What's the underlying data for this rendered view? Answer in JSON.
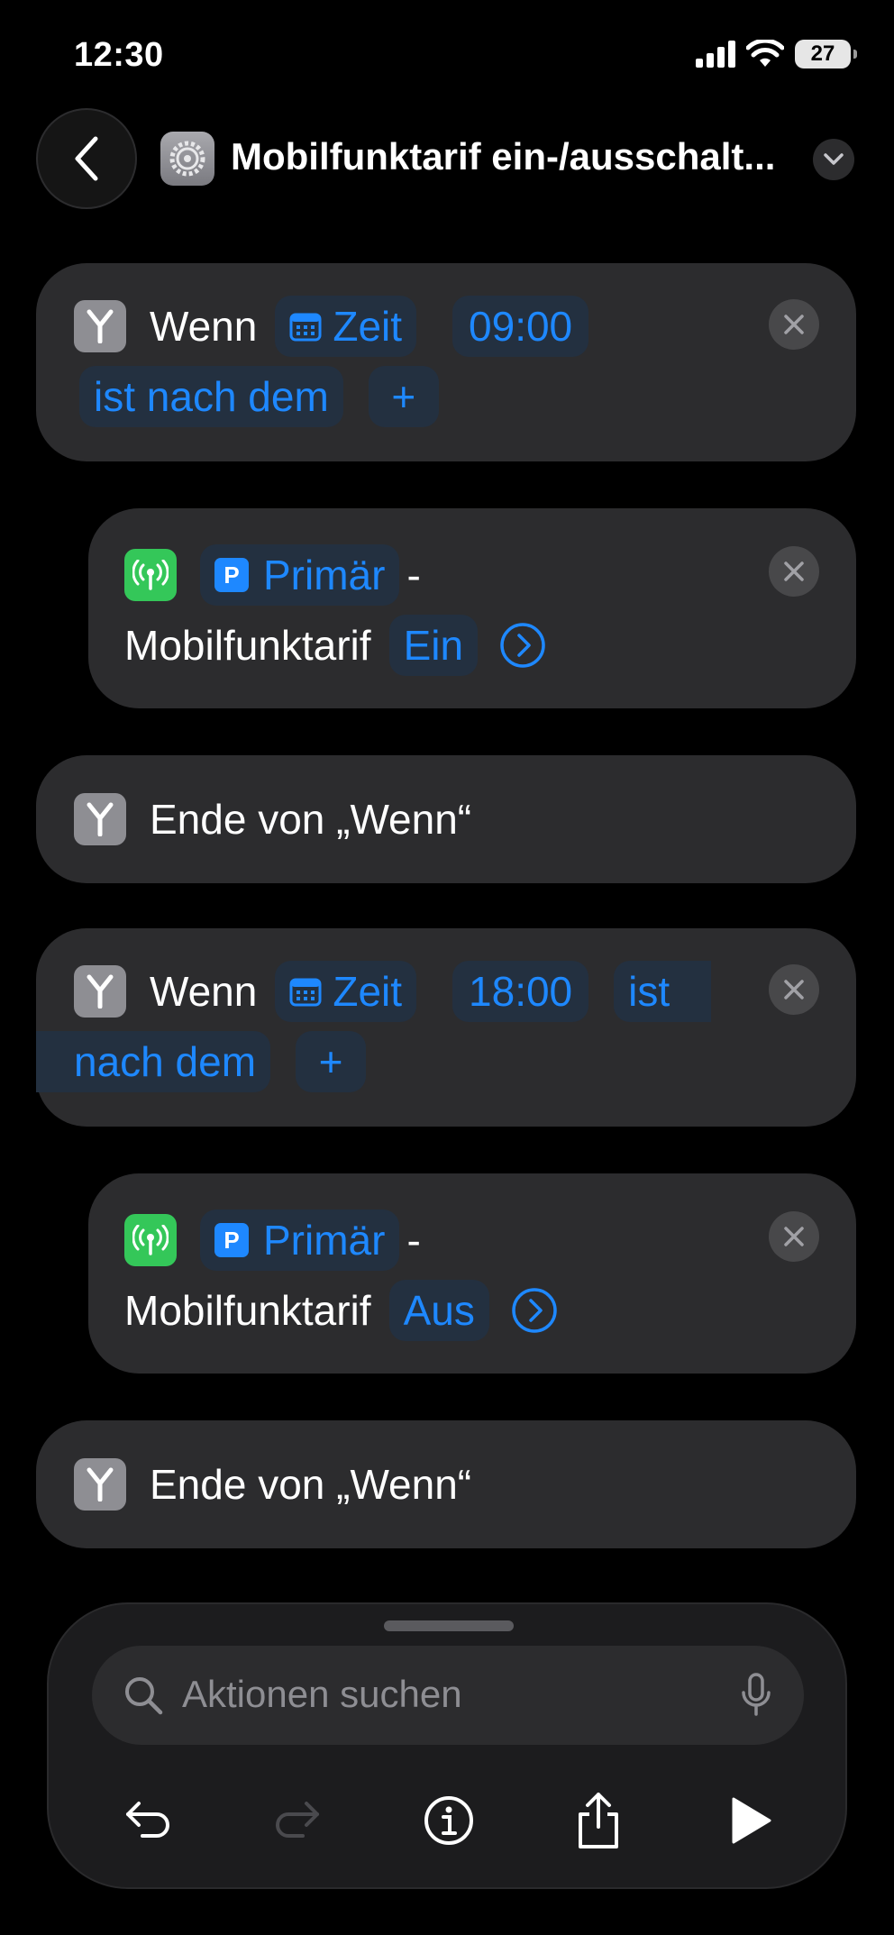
{
  "status": {
    "time": "12:30",
    "battery": "27"
  },
  "nav": {
    "title": "Mobilfunktarif ein-/ausschalt..."
  },
  "blocks": {
    "if1": {
      "keyword": "Wenn",
      "var_label": "Zeit",
      "time_value": "09:00",
      "condition": "ist nach dem",
      "add": "+"
    },
    "action1": {
      "plan": "Primär",
      "dash": "-",
      "label": "Mobilfunktarif",
      "state": "Ein"
    },
    "end1": {
      "label": "Ende von „Wenn“"
    },
    "if2": {
      "keyword": "Wenn",
      "var_label": "Zeit",
      "time_value": "18:00",
      "condition_part1": "ist",
      "condition_part2": "nach dem",
      "add": "+"
    },
    "action2": {
      "plan": "Primär",
      "dash": "-",
      "label": "Mobilfunktarif",
      "state": "Aus"
    },
    "end2": {
      "label": "Ende von „Wenn“"
    }
  },
  "search": {
    "placeholder": "Aktionen suchen"
  },
  "icons": {
    "if": "branch-icon",
    "cellular": "cellular-antenna-icon",
    "calendar": "calendar-icon",
    "close": "close-icon"
  },
  "colors": {
    "accent": "#1e88ff",
    "card": "#2c2c2e",
    "green": "#34c759"
  }
}
